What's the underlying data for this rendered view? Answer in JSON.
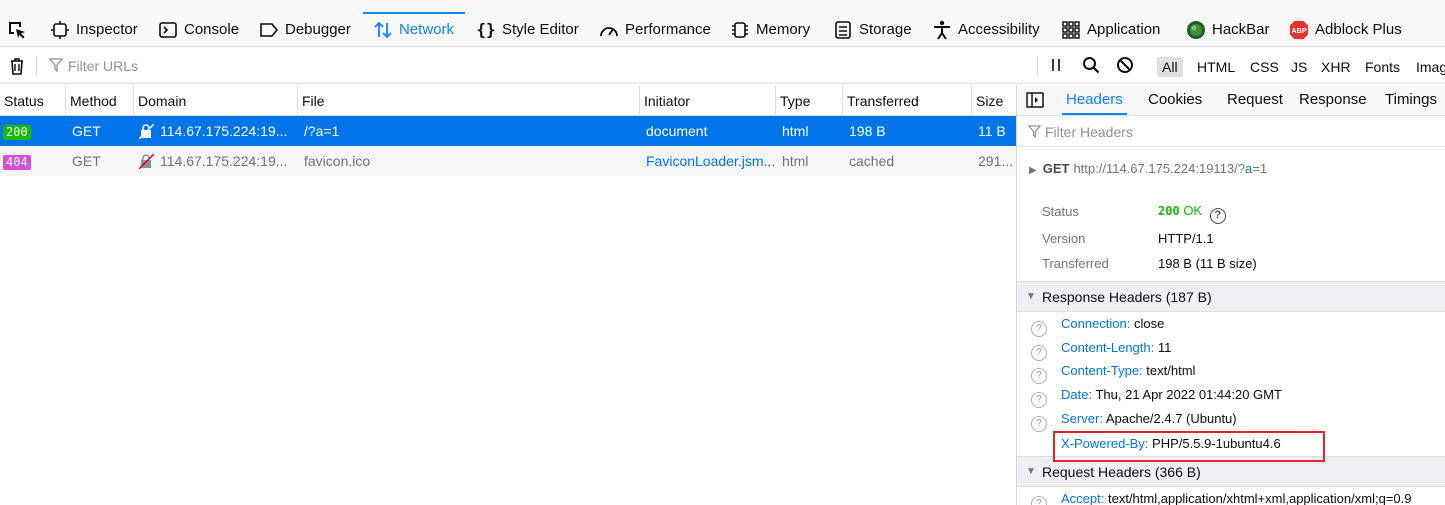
{
  "toolbar": {
    "tabs": [
      {
        "label": "Inspector",
        "icon": "inspector-icon"
      },
      {
        "label": "Console",
        "icon": "console-icon"
      },
      {
        "label": "Debugger",
        "icon": "debugger-icon"
      },
      {
        "label": "Network",
        "icon": "network-icon",
        "active": true
      },
      {
        "label": "Style Editor",
        "icon": "braces-icon"
      },
      {
        "label": "Performance",
        "icon": "gauge-icon"
      },
      {
        "label": "Memory",
        "icon": "memory-chip-icon"
      },
      {
        "label": "Storage",
        "icon": "storage-icon"
      },
      {
        "label": "Accessibility",
        "icon": "accessibility-icon"
      },
      {
        "label": "Application",
        "icon": "grid-icon"
      },
      {
        "label": "HackBar",
        "icon": "hackbar-icon"
      },
      {
        "label": "Adblock Plus",
        "icon": "abp-icon"
      }
    ],
    "abp_text": "ABP"
  },
  "filterbar": {
    "placeholder": "Filter URLs",
    "types": [
      "All",
      "HTML",
      "CSS",
      "JS",
      "XHR",
      "Fonts",
      "Images"
    ]
  },
  "table": {
    "headers": [
      "Status",
      "Method",
      "Domain",
      "File",
      "Initiator",
      "Type",
      "Transferred",
      "Size"
    ],
    "rows": [
      {
        "status": "200",
        "method": "GET",
        "domain": "114.67.175.224:19...",
        "file": "/?a=1",
        "initiator": "document",
        "type": "html",
        "transferred": "198 B",
        "size": "11 B"
      },
      {
        "status": "404",
        "method": "GET",
        "domain": "114.67.175.224:19...",
        "file": "favicon.ico",
        "initiator": "FaviconLoader.jsm...",
        "type": "html",
        "transferred": "cached",
        "size": "291..."
      }
    ]
  },
  "sidebar": {
    "tabs": [
      "Headers",
      "Cookies",
      "Request",
      "Response",
      "Timings"
    ],
    "filter_placeholder": "Filter Headers",
    "request": {
      "method": "GET",
      "url_base": "http://114.67.175.224:19113/",
      "url_query_q": "?",
      "url_query_a": "a",
      "url_query_rest": "=1"
    },
    "summary": {
      "status_label": "Status",
      "status_code": "200",
      "status_text": "OK",
      "version_label": "Version",
      "version": "HTTP/1.1",
      "transferred_label": "Transferred",
      "transferred": "198 B (11 B size)"
    },
    "response_headers_title": "Response Headers (187 B)",
    "response_headers": [
      {
        "name": "Connection:",
        "value": "close"
      },
      {
        "name": "Content-Length:",
        "value": "11"
      },
      {
        "name": "Content-Type:",
        "value": "text/html"
      },
      {
        "name": "Date:",
        "value": "Thu, 21 Apr 2022 01:44:20 GMT"
      },
      {
        "name": "Server:",
        "value": "Apache/2.4.7 (Ubuntu)"
      },
      {
        "name": "X-Powered-By:",
        "value": "PHP/5.5.9-1ubuntu4.6"
      }
    ],
    "request_headers_title": "Request Headers (366 B)",
    "request_headers": [
      {
        "name": "Accept:",
        "value": "text/html,application/xhtml+xml,application/xml;q=0.9"
      }
    ]
  },
  "colors": {
    "accent": "#0a84ff",
    "selected_row": "#0074e8",
    "ok_green": "#12bc00",
    "not_found_pink": "#d54fd8",
    "highlight_red": "#e0242c"
  }
}
